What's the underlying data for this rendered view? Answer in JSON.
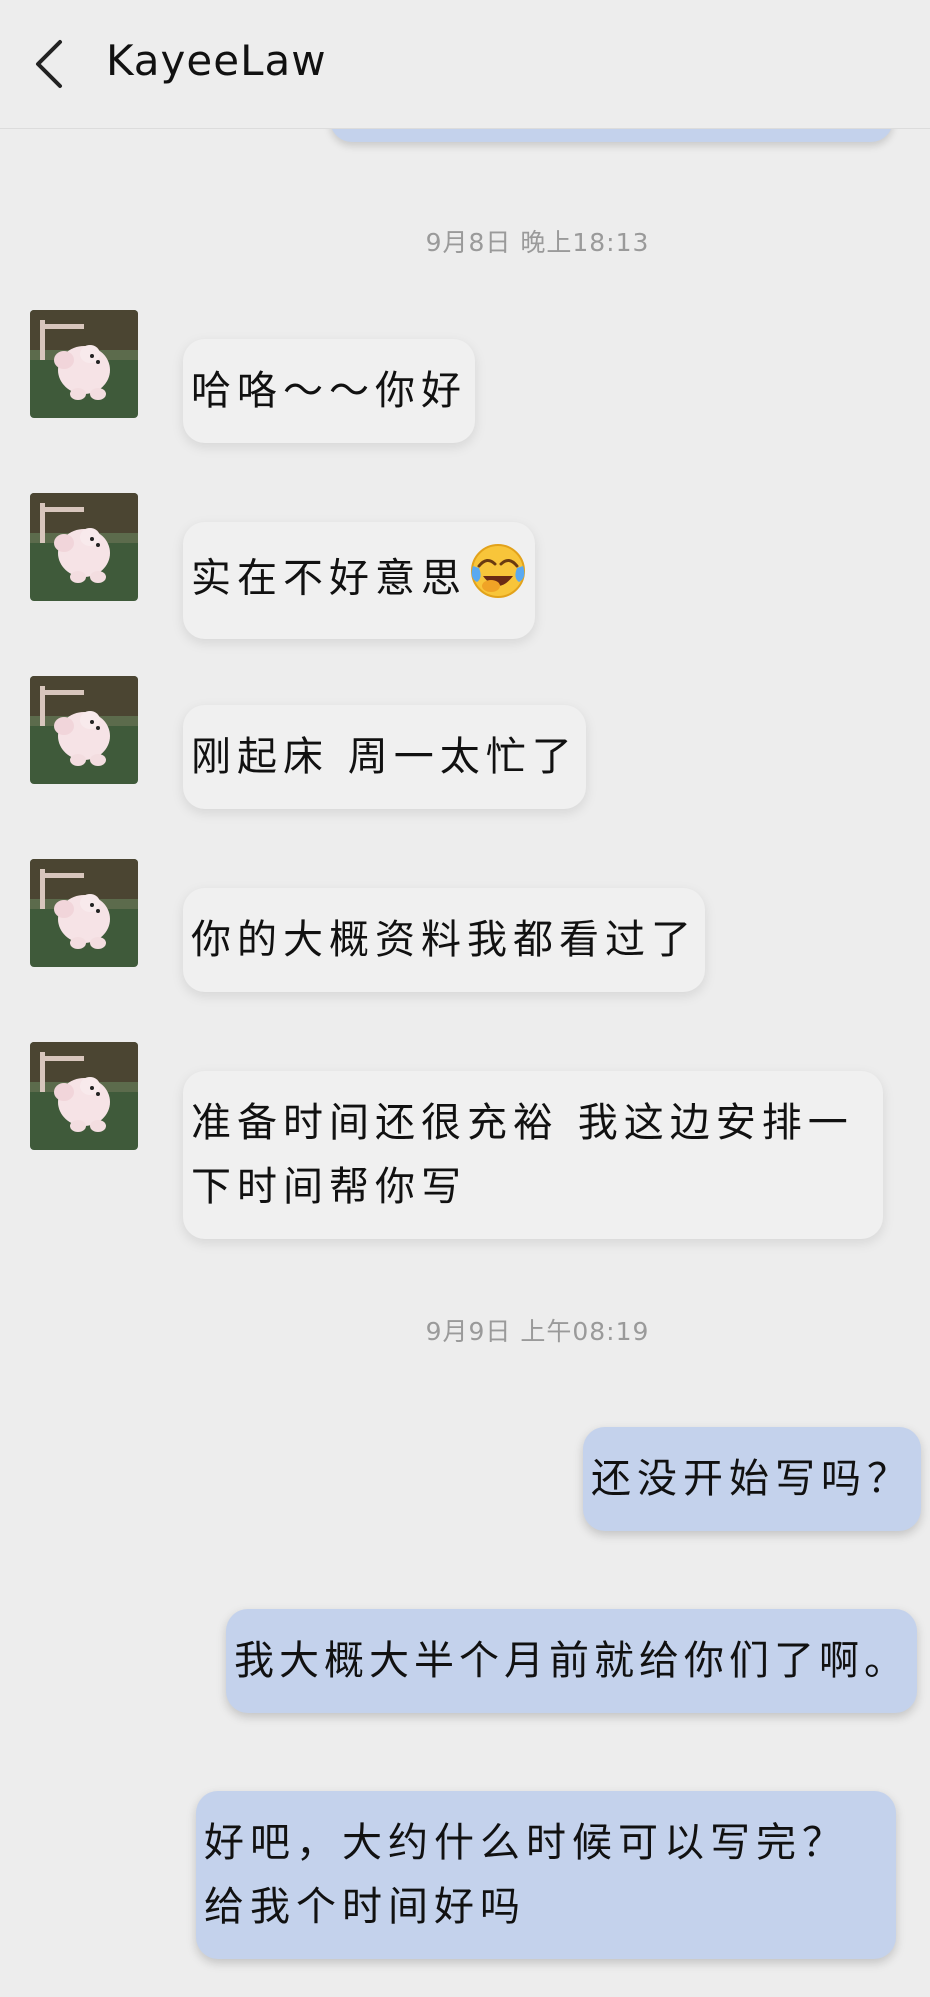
{
  "header": {
    "title": "KayeeLaw",
    "back_icon": "chevron-left-icon"
  },
  "timestamps": [
    "9月8日 晚上18:13",
    "9月9日 上午08:19"
  ],
  "messages_received": [
    {
      "text": "哈咯～～你好"
    },
    {
      "text": "实在不好意思",
      "emoji": "face-with-tears-of-joy-icon"
    },
    {
      "text": "刚起床 周一太忙了"
    },
    {
      "text": "你的大概资料我都看过了"
    },
    {
      "text": "准备时间还很充裕 我这边安排一下时间帮你写"
    }
  ],
  "messages_sent": [
    {
      "text": "还没开始写吗？"
    },
    {
      "text": "我大概大半个月前就给你们了啊。"
    },
    {
      "text": "好吧，大约什么时候可以写完？给我个时间好吗"
    }
  ],
  "colors": {
    "background": "#ededed",
    "received_bubble": "#f0f0f0",
    "sent_bubble": "#c4d2ec",
    "timestamp_text": "#9a9a9a"
  }
}
